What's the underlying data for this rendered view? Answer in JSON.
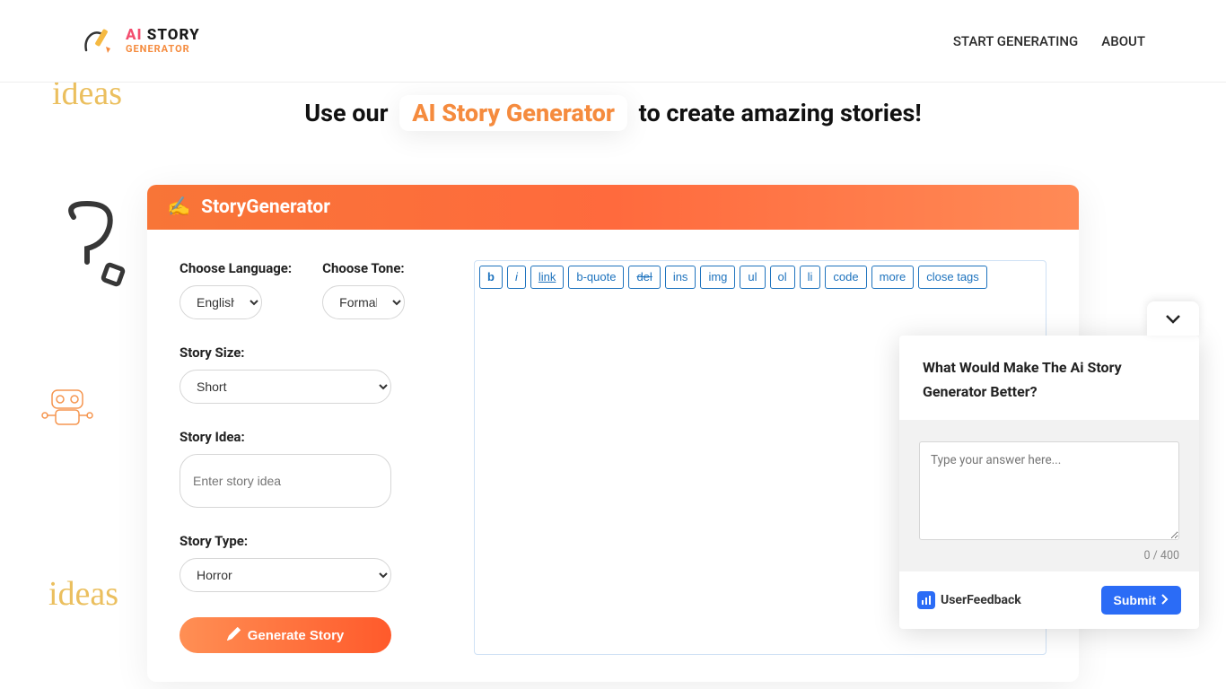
{
  "header": {
    "logo_line1_ai": "AI",
    "logo_line1_rest": " STORY",
    "logo_line2": "GENERATOR",
    "nav": {
      "start": "START GENERATING",
      "about": "ABOUT"
    }
  },
  "tagline": {
    "pre": "Use our",
    "highlight": "AI Story Generator",
    "post": "to create amazing stories!"
  },
  "card": {
    "title": "StoryGenerator",
    "labels": {
      "language": "Choose Language:",
      "tone": "Choose Tone:",
      "size": "Story Size:",
      "idea": "Story Idea:",
      "type": "Story Type:"
    },
    "values": {
      "language": "English",
      "tone": "Formal",
      "size": "Short",
      "type": "Horror"
    },
    "idea_placeholder": "Enter story idea",
    "generate_label": "Generate Story"
  },
  "toolbar": {
    "buttons": [
      "b",
      "i",
      "link",
      "b-quote",
      "del",
      "ins",
      "img",
      "ul",
      "ol",
      "li",
      "code",
      "more",
      "close tags"
    ]
  },
  "feedback": {
    "question": "What Would Make The Ai Story Generator Better?",
    "placeholder": "Type your answer here...",
    "count": "0 / 400",
    "brand": "UserFeedback",
    "submit": "Submit"
  },
  "doodles": {
    "ideas": "ideas"
  }
}
